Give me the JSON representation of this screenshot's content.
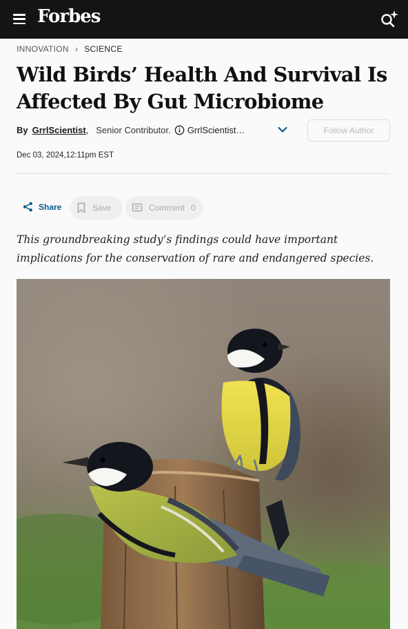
{
  "header": {
    "logo": "Forbes",
    "menu_icon": "hamburger-menu-icon",
    "search_icon": "search-sparkle-icon",
    "background": "#141414"
  },
  "breadcrumb": {
    "items": [
      "INNOVATION",
      "SCIENCE"
    ]
  },
  "article": {
    "headline": "Wild Birds’ Health And Survival Is Affected By Gut Microbiome",
    "byline": {
      "by": "By",
      "author": "GrrlScientist",
      "role": "Senior Contributor.",
      "handle": "GrrlScientist…",
      "follow_label": "Follow Author"
    },
    "date": "Dec 03, 2024,12:11pm EST",
    "actions": {
      "share": "Share",
      "save": "Save",
      "comment": "Comment",
      "comment_count": "0"
    },
    "dek": "This groundbreaking study’s findings could have important implications for the conservation of rare and endangered species.",
    "image": "photo-two-great-tits-on-wooden-post"
  },
  "colors": {
    "accent": "#0a5a8e",
    "bird_yellow": "#e8dc45",
    "bird_black": "#14161e"
  }
}
